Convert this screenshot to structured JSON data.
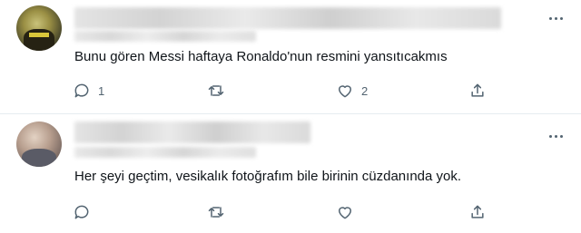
{
  "tweets": [
    {
      "text": "Bunu gören Messi haftaya Ronaldo'nun resmini yansıtıcakmıs",
      "reply_count": "1",
      "retweet_count": "",
      "like_count": "2"
    },
    {
      "text": "Her şeyi geçtim, vesikalık fotoğrafım bile birinin cüzdanında yok.",
      "reply_count": "",
      "retweet_count": "",
      "like_count": ""
    }
  ],
  "icons": {
    "reply": "reply-icon",
    "retweet": "retweet-icon",
    "like": "heart-icon",
    "share": "share-icon",
    "more": "more-icon"
  },
  "colors": {
    "text": "#0f1419",
    "icon": "#536471",
    "divider": "#e6ecf0"
  }
}
